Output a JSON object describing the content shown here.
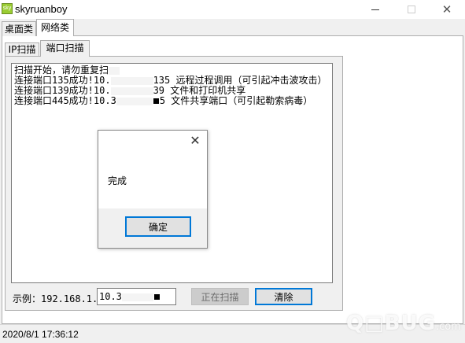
{
  "window": {
    "app_icon_text": "sky",
    "title": "skyruanboy",
    "close_glyph": "✕"
  },
  "main_tabs": [
    {
      "label": "桌面类"
    },
    {
      "label": "网络类"
    }
  ],
  "sub_tabs": [
    {
      "label": "IP扫描"
    },
    {
      "label": "端口扫描"
    }
  ],
  "log": {
    "line1": "扫描开始，请勿重复扫",
    "line2_prefix": "连接端口135成功!10.",
    "line2_suffix": "135 远程过程调用（可引起冲击波攻击）",
    "line3_prefix": "连接端口139成功!10.",
    "line3_suffix": "39 文件和打印机共享",
    "line4_prefix": "连接端口445成功!10.3",
    "line4_suffix": "5 文件共享端口（可引起勒索病毒）"
  },
  "example": {
    "label": "示例：192.168.1.1"
  },
  "ip_input": {
    "value": "10.3"
  },
  "buttons": {
    "scanning": "正在扫描",
    "clear": "清除"
  },
  "status": {
    "datetime": "2020/8/1 17:36:12"
  },
  "watermark": {
    "text": "Q□BUG",
    "suffix": ".com"
  },
  "dialog": {
    "close_glyph": "✕",
    "message": "完成",
    "ok": "确定"
  },
  "colors": {
    "accent": "#0078d7",
    "disabled_button": "#cccccc",
    "panel_bg": "#f0f0f0"
  }
}
